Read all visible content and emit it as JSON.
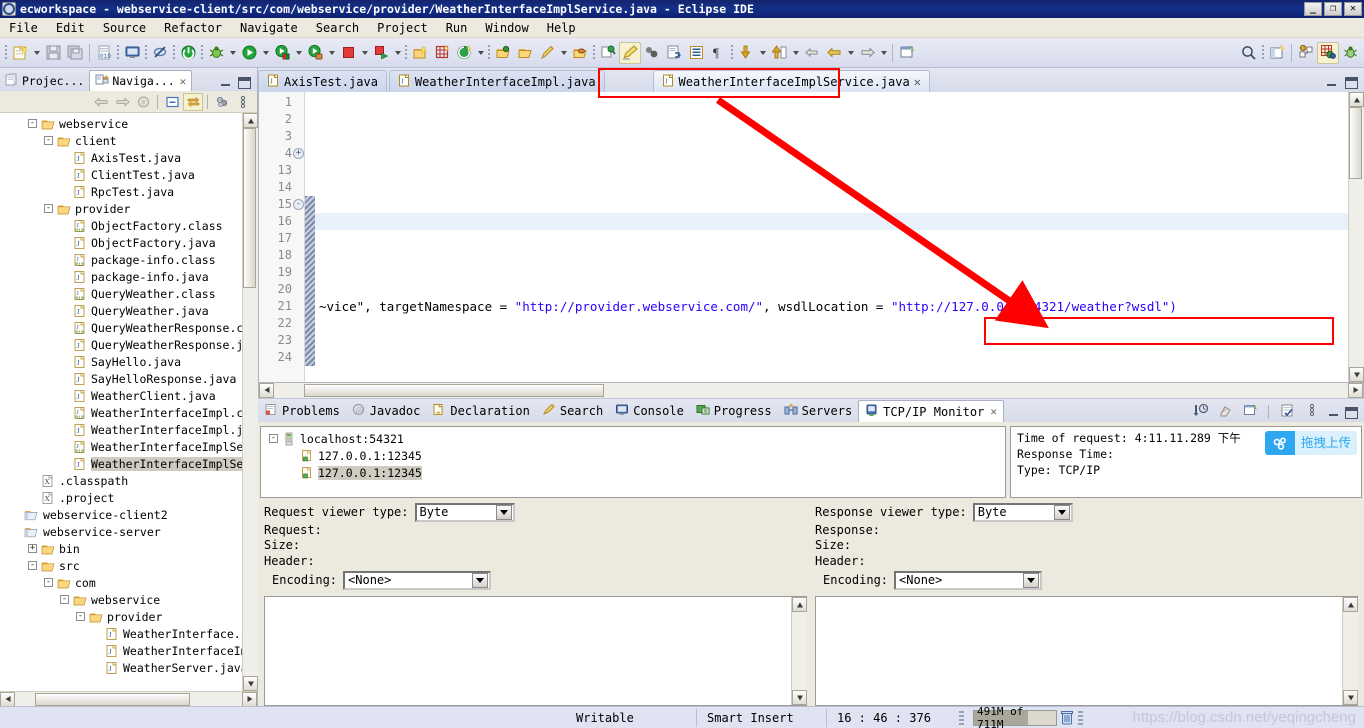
{
  "window": {
    "title": "ecworkspace - webservice-client/src/com/webservice/provider/WeatherInterfaceImplService.java - Eclipse IDE",
    "minimize": "_",
    "maximize": "❐",
    "close": "✕",
    "app_icon": "eclipse-icon"
  },
  "menubar": {
    "items": [
      "File",
      "Edit",
      "Source",
      "Refactor",
      "Navigate",
      "Search",
      "Project",
      "Run",
      "Window",
      "Help"
    ]
  },
  "toolbar": {
    "icons": [
      "new-wizard-icon",
      "save-icon",
      "save-all-icon",
      "new-class-file-icon",
      "open-console-icon",
      "skip-breakpoints-icon",
      "terminate-icon",
      "debug-icon",
      "run-icon",
      "run-server-icon",
      "profile-icon",
      "stop-red-icon",
      "run-last-icon",
      "new-java-project-icon",
      "new-annotation-icon",
      "new-package-icon",
      "open-type-icon",
      "open-folder-icon",
      "pencil-icon",
      "open-task-icon",
      "search-marker-icon",
      "highlight-icon",
      "link-icon",
      "export-icon",
      "toggle-block-icon",
      "pilcrow-icon",
      "next-annotation-icon",
      "prev-annotation-icon",
      "back-icon",
      "forward-icon",
      "new-window-icon",
      "search-icon",
      "new-perspective-icon",
      "java-perspective-icon",
      "java-ee-perspective-icon",
      "debug-perspective-icon"
    ]
  },
  "left_panel": {
    "tabs": [
      {
        "label": "Projec...",
        "icon": "project-explorer-icon",
        "active": false
      },
      {
        "label": "Naviga...",
        "icon": "navigator-icon",
        "active": true,
        "close": "✕"
      }
    ],
    "view_toolbar": [
      "back-icon",
      "forward-icon",
      "home-icon",
      "collapse-all-icon",
      "link-with-editor-icon",
      "view-menu-icon",
      "view-dots-icon"
    ],
    "minimize": "minimize-icon",
    "maximize": "maximize-icon",
    "tree": [
      {
        "depth": 1,
        "twist": "-",
        "icon": "folder-open-icon",
        "label": "webservice"
      },
      {
        "depth": 2,
        "twist": "-",
        "icon": "folder-open-icon",
        "label": "client"
      },
      {
        "depth": 3,
        "twist": "",
        "icon": "java-file-icon",
        "label": "AxisTest.java"
      },
      {
        "depth": 3,
        "twist": "",
        "icon": "java-file-icon",
        "label": "ClientTest.java"
      },
      {
        "depth": 3,
        "twist": "",
        "icon": "java-file-icon",
        "label": "RpcTest.java"
      },
      {
        "depth": 2,
        "twist": "-",
        "icon": "folder-open-icon",
        "label": "provider"
      },
      {
        "depth": 3,
        "twist": "",
        "icon": "class-file-icon",
        "label": "ObjectFactory.class"
      },
      {
        "depth": 3,
        "twist": "",
        "icon": "java-file-icon",
        "label": "ObjectFactory.java"
      },
      {
        "depth": 3,
        "twist": "",
        "icon": "class-file-icon",
        "label": "package-info.class"
      },
      {
        "depth": 3,
        "twist": "",
        "icon": "java-file-icon",
        "label": "package-info.java"
      },
      {
        "depth": 3,
        "twist": "",
        "icon": "class-file-icon",
        "label": "QueryWeather.class"
      },
      {
        "depth": 3,
        "twist": "",
        "icon": "java-file-icon",
        "label": "QueryWeather.java"
      },
      {
        "depth": 3,
        "twist": "",
        "icon": "class-file-icon",
        "label": "QueryWeatherResponse.c"
      },
      {
        "depth": 3,
        "twist": "",
        "icon": "java-file-icon",
        "label": "QueryWeatherResponse.j"
      },
      {
        "depth": 3,
        "twist": "",
        "icon": "java-file-icon",
        "label": "SayHello.java"
      },
      {
        "depth": 3,
        "twist": "",
        "icon": "java-file-icon",
        "label": "SayHelloResponse.java"
      },
      {
        "depth": 3,
        "twist": "",
        "icon": "java-file-icon",
        "label": "WeatherClient.java"
      },
      {
        "depth": 3,
        "twist": "",
        "icon": "class-file-icon",
        "label": "WeatherInterfaceImpl.c"
      },
      {
        "depth": 3,
        "twist": "",
        "icon": "java-file-icon",
        "label": "WeatherInterfaceImpl.j"
      },
      {
        "depth": 3,
        "twist": "",
        "icon": "class-file-icon",
        "label": "WeatherInterfaceImplSe"
      },
      {
        "depth": 3,
        "twist": "",
        "icon": "java-file-icon",
        "label": "WeatherInterfaceImplSe",
        "selected": true
      },
      {
        "depth": 1,
        "twist": "",
        "icon": "xml-file-icon",
        "label": ".classpath"
      },
      {
        "depth": 1,
        "twist": "",
        "icon": "xml-file-icon",
        "label": ".project"
      },
      {
        "depth": 0,
        "twist": "",
        "icon": "project-icon",
        "label": "webservice-client2"
      },
      {
        "depth": 0,
        "twist": "",
        "icon": "project-icon",
        "label": "webservice-server"
      },
      {
        "depth": 1,
        "twist": "+",
        "icon": "folder-open-icon",
        "label": "bin"
      },
      {
        "depth": 1,
        "twist": "-",
        "icon": "folder-open-icon",
        "label": "src"
      },
      {
        "depth": 2,
        "twist": "-",
        "icon": "folder-open-icon",
        "label": "com"
      },
      {
        "depth": 3,
        "twist": "-",
        "icon": "folder-open-icon",
        "label": "webservice"
      },
      {
        "depth": 4,
        "twist": "-",
        "icon": "folder-open-icon",
        "label": "provider"
      },
      {
        "depth": 5,
        "twist": "",
        "icon": "java-file-icon",
        "label": "WeatherInterface.java"
      },
      {
        "depth": 5,
        "twist": "",
        "icon": "java-file-icon",
        "label": "WeatherInterfaceImpl.j"
      },
      {
        "depth": 5,
        "twist": "",
        "icon": "java-file-icon",
        "label": "WeatherServer.java"
      }
    ]
  },
  "editor": {
    "tabs": [
      {
        "label": "AxisTest.java",
        "icon": "java-file-icon",
        "active": false
      },
      {
        "label": "WeatherInterfaceImpl.java",
        "icon": "java-file-icon",
        "active": false
      },
      {
        "label": "WeatherInterfaceImplService.java",
        "icon": "java-file-icon",
        "active": true,
        "close": "✕",
        "highlighted": true
      }
    ],
    "minimize": "minimize-icon",
    "maximize": "maximize-icon",
    "lines": [
      {
        "num": "1",
        "fold": "",
        "text": "",
        "highlight": false,
        "annot": false
      },
      {
        "num": "2",
        "fold": "",
        "text": "",
        "highlight": false,
        "annot": false
      },
      {
        "num": "3",
        "fold": "",
        "text": "",
        "highlight": false,
        "annot": false
      },
      {
        "num": "4",
        "fold": "+",
        "text": "",
        "highlight": false,
        "annot": false
      },
      {
        "num": "13",
        "fold": "",
        "text": "",
        "highlight": false,
        "annot": false
      },
      {
        "num": "14",
        "fold": "",
        "text": "",
        "highlight": false,
        "annot": false
      },
      {
        "num": "15",
        "fold": "-",
        "text": "",
        "highlight": false,
        "annot": true
      },
      {
        "num": "16",
        "fold": "",
        "text": "",
        "highlight": true,
        "annot": true
      },
      {
        "num": "17",
        "fold": "",
        "text": "",
        "highlight": false,
        "annot": true
      },
      {
        "num": "18",
        "fold": "",
        "text": "",
        "highlight": false,
        "annot": true
      },
      {
        "num": "19",
        "fold": "",
        "text": "",
        "highlight": false,
        "annot": true
      },
      {
        "num": "20",
        "fold": "",
        "text": "",
        "highlight": false,
        "annot": true
      },
      {
        "num": "21",
        "fold": "",
        "text": "CODE21",
        "highlight": false,
        "annot": true
      },
      {
        "num": "22",
        "fold": "",
        "text": "",
        "highlight": false,
        "annot": true
      },
      {
        "num": "23",
        "fold": "",
        "text": "",
        "highlight": false,
        "annot": true
      },
      {
        "num": "24",
        "fold": "",
        "text": "",
        "highlight": false,
        "annot": true
      }
    ],
    "code_line_21": {
      "prefix": "~vice\", targetNamespace = ",
      "namespace_string": "\"http://provider.webservice.com/\"",
      "middle": ", wsdlLocation = ",
      "wsdl_string": "\"http://127.0.0.1:54321/weather?wsdl\")",
      "string_color": "#2a00ff"
    }
  },
  "bottom_panel": {
    "tabs": [
      {
        "label": "Problems",
        "icon": "problems-icon",
        "active": false
      },
      {
        "label": "Javadoc",
        "icon": "javadoc-icon",
        "active": false
      },
      {
        "label": "Declaration",
        "icon": "declaration-icon",
        "active": false
      },
      {
        "label": "Search",
        "icon": "search-icon",
        "active": false
      },
      {
        "label": "Console",
        "icon": "console-icon",
        "active": false
      },
      {
        "label": "Progress",
        "icon": "progress-icon",
        "active": false
      },
      {
        "label": "Servers",
        "icon": "servers-icon",
        "active": false
      },
      {
        "label": "TCP/IP Monitor",
        "icon": "tcpip-monitor-icon",
        "active": true,
        "close": "✕"
      }
    ],
    "view_toolbar": [
      "sort-by-time-icon",
      "clear-icon",
      "properties-icon",
      "edit-icon",
      "view-menu-icon"
    ],
    "minimize": "minimize-icon",
    "maximize": "maximize-icon",
    "monitor_tree": [
      {
        "depth": 0,
        "twist": "-",
        "icon": "server-icon",
        "label": "localhost:54321"
      },
      {
        "depth": 1,
        "twist": "",
        "icon": "request-icon",
        "label": "127.0.0.1:12345",
        "selected": false
      },
      {
        "depth": 1,
        "twist": "",
        "icon": "request-icon",
        "label": "127.0.0.1:12345",
        "selected": true
      }
    ],
    "info": {
      "time_of_request": "Time of request: 4:11.11.289 下午",
      "response_time": "Response Time:",
      "type": "Type: TCP/IP"
    },
    "request": {
      "viewer_type_label": "Request viewer type:",
      "viewer_type_value": "Byte",
      "header_label_1": "Request:",
      "header_label_2": "Size:",
      "header_label_3": "Header:",
      "encoding_label": "Encoding:",
      "encoding_value": "<None>"
    },
    "response": {
      "viewer_type_label": "Response viewer type:",
      "viewer_type_value": "Byte",
      "header_label_1": "Response:",
      "header_label_2": "Size:",
      "header_label_3": "Header:",
      "encoding_label": "Encoding:",
      "encoding_value": "<None>"
    }
  },
  "statusbar": {
    "writable": "Writable",
    "insert_mode": "Smart Insert",
    "position": "16 : 46 : 376",
    "memory": "491M of 711M",
    "trash_icon": "trash-icon",
    "watermark": "https://blog.csdn.net/yeqingcheng"
  },
  "overlay": {
    "pan_chip_label": "拖拽上传",
    "pan_chip_icon": "baidu-pan-icon",
    "annotation_color": "#ff0000"
  }
}
